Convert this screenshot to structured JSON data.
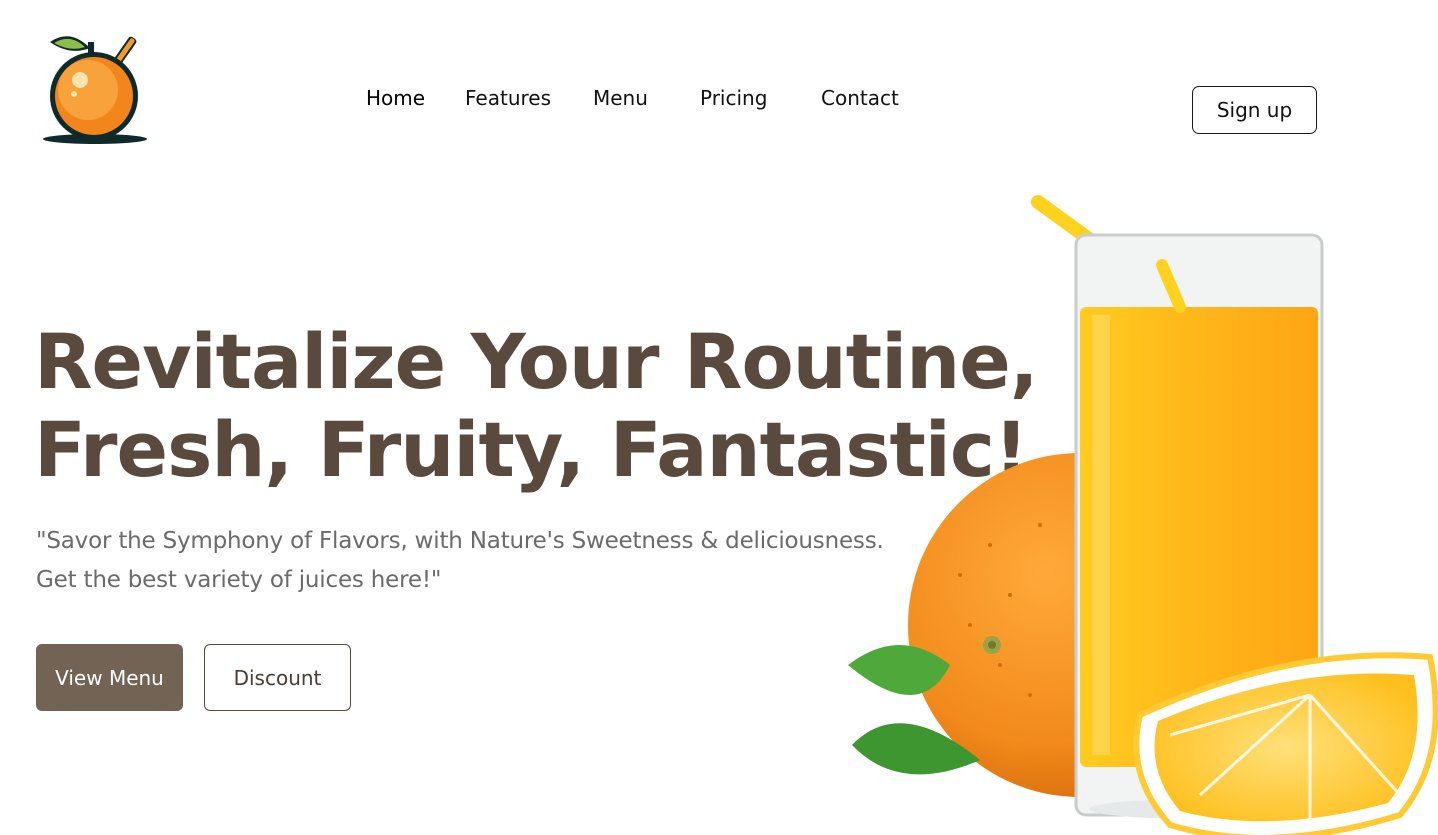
{
  "nav": {
    "items": [
      {
        "label": "Home",
        "active": true
      },
      {
        "label": "Features",
        "active": false
      },
      {
        "label": "Menu",
        "active": false
      },
      {
        "label": "Pricing",
        "active": false
      },
      {
        "label": "Contact",
        "active": false
      }
    ],
    "signup_label": "Sign up"
  },
  "logo": {
    "icon": "orange-with-straw-icon"
  },
  "hero": {
    "title_line1": "Revitalize Your Routine,",
    "title_line2": "Fresh, Fruity, Fantastic!",
    "subtitle_line1": "\"Savor the Symphony of Flavors, with Nature's Sweetness & deliciousness.",
    "subtitle_line2": "Get the best variety of juices here!\"",
    "primary_button": "View Menu",
    "secondary_button": "Discount",
    "image": "orange-juice-glass-with-oranges"
  },
  "colors": {
    "title": "#5a4a3d",
    "primary_button": "#726355",
    "subtitle": "#6b6b6b",
    "juice": "#ffb31a",
    "orange": "#f28a1c"
  }
}
